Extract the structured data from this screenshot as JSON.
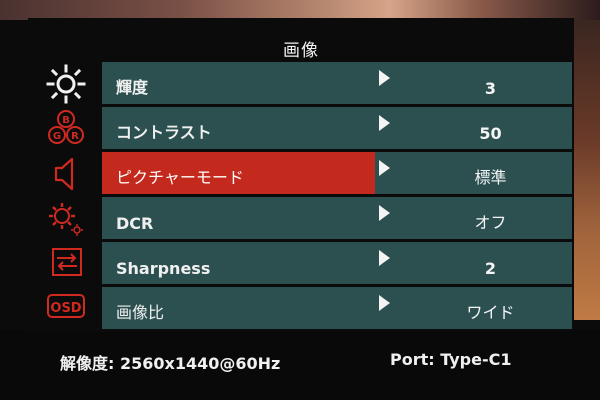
{
  "title": "画像",
  "menu": [
    {
      "label": "輝度",
      "value": "3"
    },
    {
      "label": "コントラスト",
      "value": "50"
    },
    {
      "label": "ピクチャーモード",
      "value": "標準",
      "selected": true
    },
    {
      "label": "DCR",
      "value": "オフ"
    },
    {
      "label": "Sharpness",
      "value": "2"
    },
    {
      "label": "画像比",
      "value": "ワイド"
    }
  ],
  "sidebar_icons": [
    {
      "name": "brightness-icon",
      "active": true
    },
    {
      "name": "color-rgb-icon",
      "letters": [
        "B",
        "G",
        "R"
      ]
    },
    {
      "name": "speaker-icon"
    },
    {
      "name": "settings-gear-icon"
    },
    {
      "name": "input-source-icon"
    },
    {
      "name": "osd-icon",
      "text": "OSD"
    }
  ],
  "status": {
    "resolution_label": "解像度:",
    "resolution_value": "2560x1440@60Hz",
    "port_label": "Port:",
    "port_value": "Type-C1"
  },
  "colors": {
    "row_bg": "#2c5050",
    "selected_bg": "#c4291d",
    "icon_red": "#d02a20",
    "text": "#f0f0f0"
  }
}
